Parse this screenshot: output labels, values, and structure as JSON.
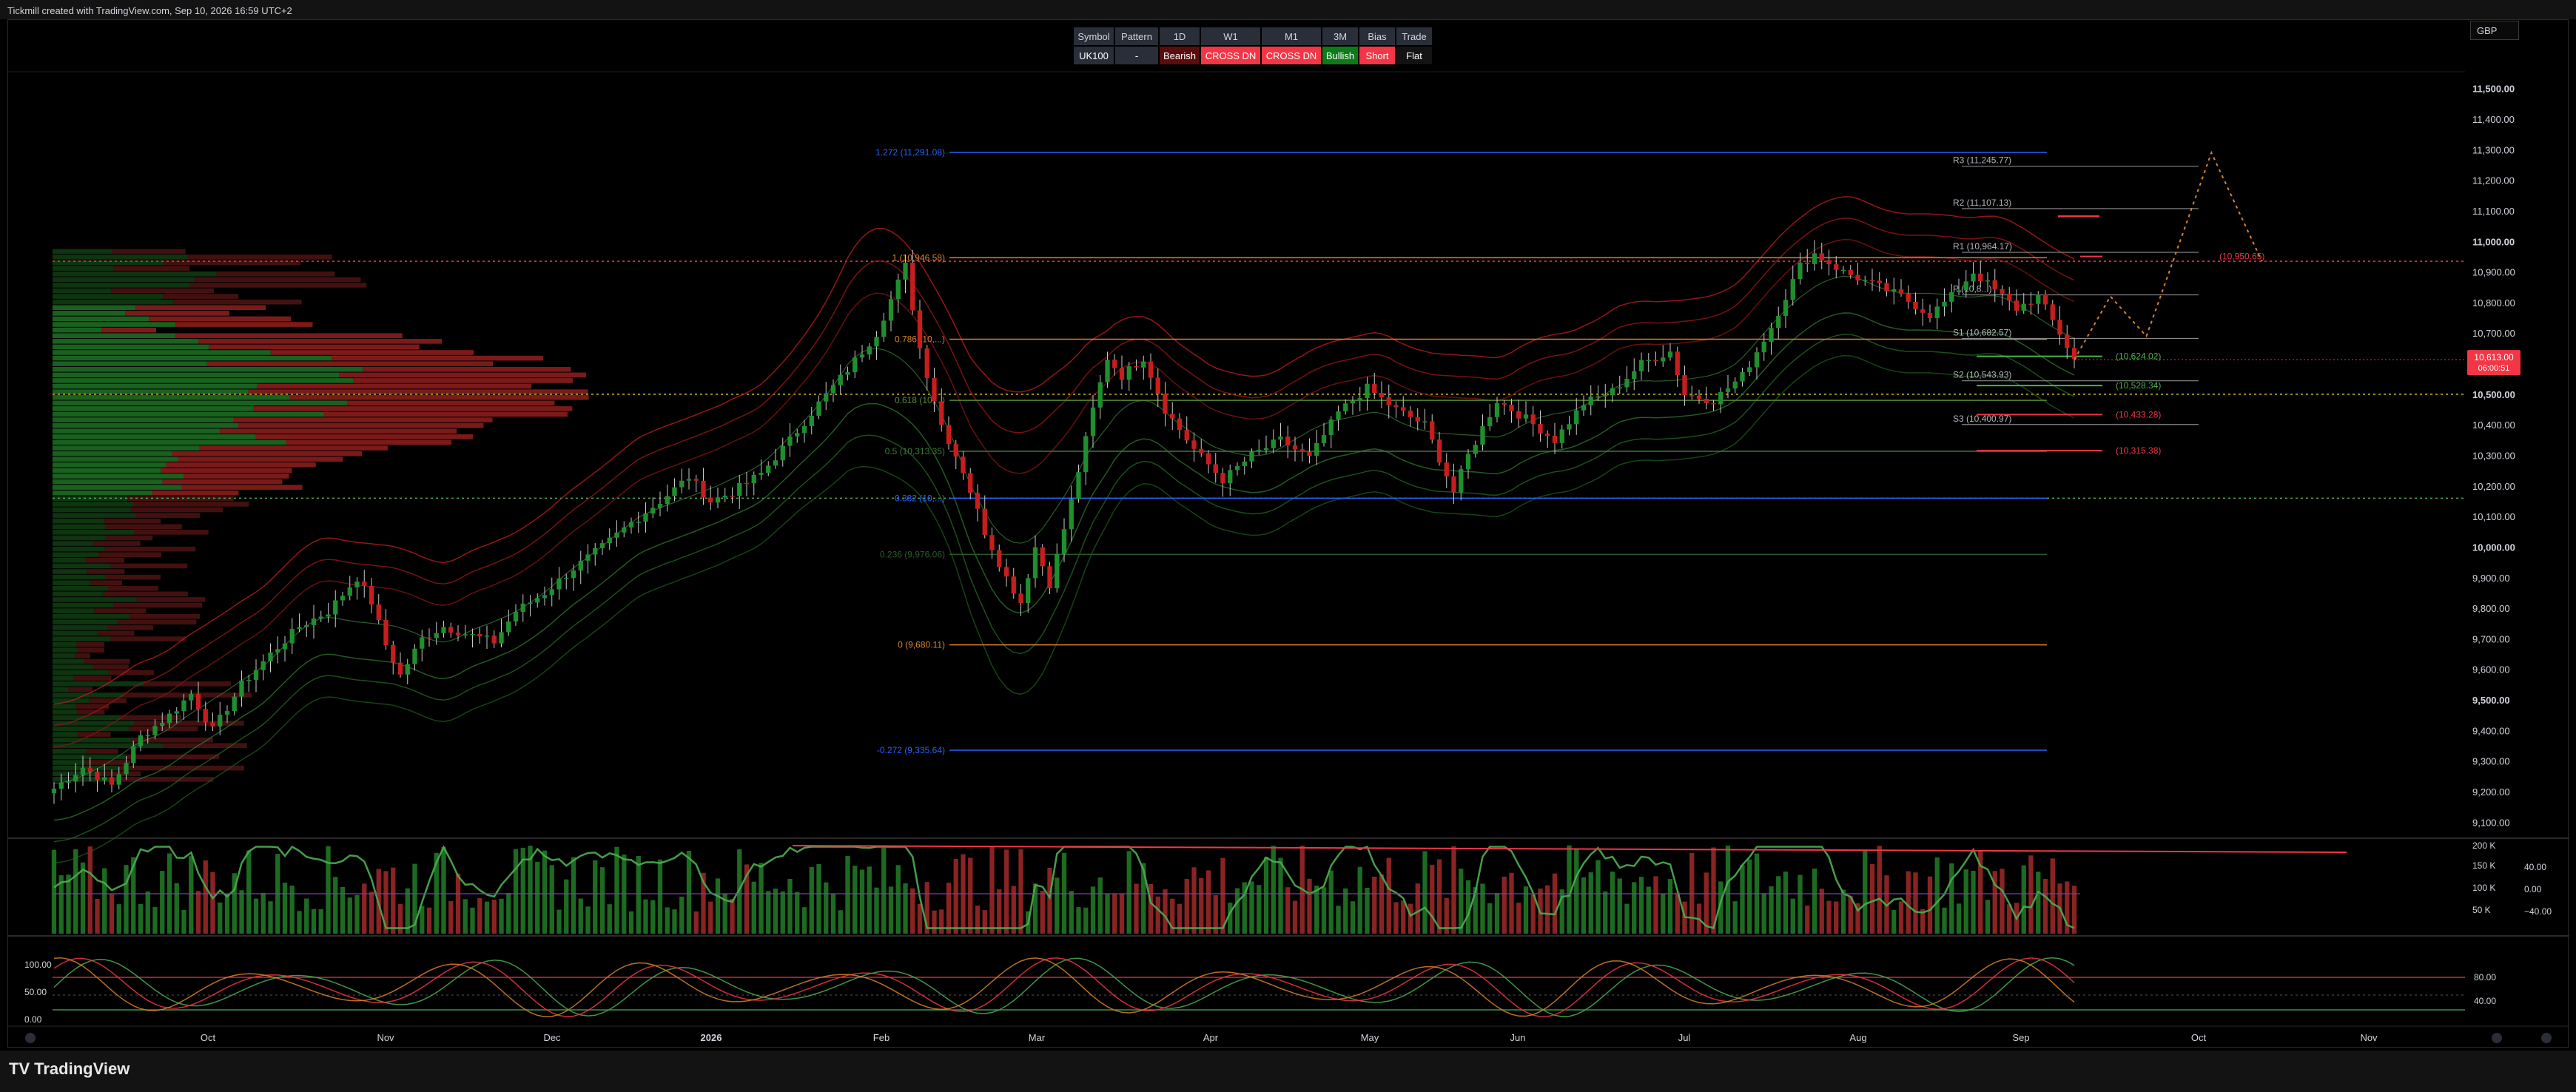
{
  "header": {
    "created_with": "Tickmill created with TradingView.com, Sep 10, 2026 16:59 UTC+2"
  },
  "currency_button": "GBP",
  "brand": {
    "mark": "TV",
    "name": "TradingView"
  },
  "colors": {
    "bull": "#1f8f2e",
    "bear": "#c81d1d",
    "fib_orange": "#d9822b",
    "fib_blue": "#2962ff",
    "poc": "#d4c316",
    "price_tag": "#f23645"
  },
  "info_table": {
    "headers": [
      "Symbol",
      "Pattern",
      "1D",
      "W1",
      "M1",
      "3M",
      "Bias",
      "Trade"
    ],
    "values": [
      "UK100",
      "-",
      "Bearish",
      "CROSS DN",
      "CROSS DN",
      "Bullish",
      "Short",
      "Flat"
    ],
    "cell_colors": [
      "#2a2e39",
      "#2a2e39",
      "#5a0d0d",
      "#f23645",
      "#f23645",
      "#0f7a1a",
      "#f23645",
      "#131313"
    ]
  },
  "chart_data": {
    "type": "candlestick",
    "symbol": "UK100",
    "y_axis": {
      "labels": [
        "11,500.00",
        "11,400.00",
        "11,300.00",
        "11,200.00",
        "11,100.00",
        "11,000.00",
        "10,900.00",
        "10,800.00",
        "10,700.00",
        "10,600.00",
        "10,500.00",
        "10,400.00",
        "10,300.00",
        "10,200.00",
        "10,100.00",
        "10,000.00",
        "9,900.00",
        "9,800.00",
        "9,700.00",
        "9,600.00",
        "9,500.00",
        "9,400.00",
        "9,300.00",
        "9,200.00",
        "9,100.00"
      ],
      "range": [
        9050,
        11550
      ]
    },
    "x_axis": {
      "labels": [
        "Oct",
        "Nov",
        "Dec",
        "2026",
        "Feb",
        "Mar",
        "Apr",
        "May",
        "Jun",
        "Jul",
        "Aug",
        "Sep",
        "Oct",
        "Nov"
      ]
    },
    "last_price": {
      "label": "10,613.00",
      "countdown": "06:00:51",
      "value": 10613
    },
    "price_path": [
      [
        0,
        9210
      ],
      [
        4,
        9280
      ],
      [
        8,
        9220
      ],
      [
        12,
        9380
      ],
      [
        16,
        9450
      ],
      [
        19,
        9520
      ],
      [
        22,
        9400
      ],
      [
        26,
        9550
      ],
      [
        30,
        9650
      ],
      [
        34,
        9740
      ],
      [
        38,
        9790
      ],
      [
        42,
        9900
      ],
      [
        44,
        9820
      ],
      [
        46,
        9680
      ],
      [
        48,
        9580
      ],
      [
        51,
        9700
      ],
      [
        54,
        9740
      ],
      [
        58,
        9710
      ],
      [
        61,
        9690
      ],
      [
        64,
        9790
      ],
      [
        68,
        9850
      ],
      [
        72,
        9930
      ],
      [
        76,
        10000
      ],
      [
        80,
        10080
      ],
      [
        84,
        10150
      ],
      [
        88,
        10230
      ],
      [
        91,
        10150
      ],
      [
        94,
        10180
      ],
      [
        98,
        10240
      ],
      [
        102,
        10350
      ],
      [
        106,
        10470
      ],
      [
        110,
        10580
      ],
      [
        114,
        10700
      ],
      [
        116,
        10810
      ],
      [
        118,
        10920
      ],
      [
        120,
        10650
      ],
      [
        123,
        10400
      ],
      [
        126,
        10250
      ],
      [
        129,
        10050
      ],
      [
        132,
        9900
      ],
      [
        134,
        9820
      ],
      [
        136,
        10000
      ],
      [
        138,
        9880
      ],
      [
        141,
        10150
      ],
      [
        144,
        10450
      ],
      [
        146,
        10620
      ],
      [
        148,
        10560
      ],
      [
        151,
        10620
      ],
      [
        154,
        10450
      ],
      [
        158,
        10320
      ],
      [
        162,
        10220
      ],
      [
        166,
        10300
      ],
      [
        170,
        10350
      ],
      [
        174,
        10290
      ],
      [
        178,
        10440
      ],
      [
        182,
        10520
      ],
      [
        186,
        10450
      ],
      [
        190,
        10400
      ],
      [
        194,
        10180
      ],
      [
        196,
        10300
      ],
      [
        200,
        10480
      ],
      [
        204,
        10420
      ],
      [
        208,
        10350
      ],
      [
        212,
        10470
      ],
      [
        216,
        10510
      ],
      [
        220,
        10600
      ],
      [
        224,
        10640
      ],
      [
        226,
        10500
      ],
      [
        230,
        10480
      ],
      [
        234,
        10560
      ],
      [
        238,
        10720
      ],
      [
        242,
        10920
      ],
      [
        244,
        10960
      ],
      [
        248,
        10900
      ],
      [
        252,
        10860
      ],
      [
        256,
        10820
      ],
      [
        260,
        10760
      ],
      [
        263,
        10820
      ],
      [
        266,
        10900
      ],
      [
        269,
        10840
      ],
      [
        272,
        10780
      ],
      [
        275,
        10820
      ],
      [
        278,
        10700
      ],
      [
        280,
        10613
      ]
    ],
    "price_path_x_range": [
      0,
      280
    ],
    "volume_profile": {
      "rows": 95,
      "top_value": 10975,
      "bottom_value": 9230,
      "poc_value": 10500,
      "value_area_low": 10160
    },
    "fibonacci": [
      {
        "label": "1.272 (11,291.08)",
        "value": 11291.08,
        "color": "#2962ff"
      },
      {
        "label": "1 (10,946.58)",
        "value": 10946.58,
        "color": "#d9822b"
      },
      {
        "label": "0.786 (10,...)",
        "value": 10680,
        "color": "#d9822b"
      },
      {
        "label": "0.618 (10,...)",
        "value": 10480,
        "color": "#5a8a2e"
      },
      {
        "label": "0.5 (10,313.35)",
        "value": 10313.35,
        "color": "#3a7a3a"
      },
      {
        "label": "0.382 (10,...)",
        "value": 10160,
        "color": "#2962ff"
      },
      {
        "label": "0.236 (9,976.06)",
        "value": 9976.06,
        "color": "#2e5a2e"
      },
      {
        "label": "0 (9,680.11)",
        "value": 9680.11,
        "color": "#d9822b"
      },
      {
        "label": "-0.272 (9,335.64)",
        "value": 9335.64,
        "color": "#2962ff"
      }
    ],
    "pivots": [
      {
        "label": "R3 (11,245.77)",
        "value": 11245.77
      },
      {
        "label": "R2 (11,107.13)",
        "value": 11107.13
      },
      {
        "label": "R1 (10,964.17)",
        "value": 10964.17
      },
      {
        "label": "P (10,8...)",
        "value": 10825
      },
      {
        "label": "S1 (10,682.57)",
        "value": 10682.57
      },
      {
        "label": "S2 (10,543.93)",
        "value": 10543.93
      },
      {
        "label": "S3 (10,400.97)",
        "value": 10400.97
      }
    ],
    "targets": [
      {
        "label": "(10,624.02)",
        "value": 10624.02,
        "color": "#4caf50"
      },
      {
        "label": "(10,528.34)",
        "value": 10528.34,
        "color": "#4caf50"
      },
      {
        "label": "(10,433.28)",
        "value": 10433.28,
        "color": "#f23645"
      },
      {
        "label": "(10,315.38)",
        "value": 10315.38,
        "color": "#f23645"
      },
      {
        "label": "(10,950.65)",
        "value": 10950.65,
        "color": "#f23645"
      }
    ],
    "horizontal_lines": [
      {
        "value": 10935,
        "color": "#f23645",
        "style": "dotted"
      },
      {
        "value": 10500,
        "color": "#d4c316",
        "style": "dotted"
      },
      {
        "value": 10160,
        "color": "#4caf50",
        "style": "dotted"
      }
    ],
    "projection": [
      [
        280,
        10613
      ],
      [
        285,
        10820
      ],
      [
        290,
        10690
      ],
      [
        299,
        11290
      ],
      [
        306,
        10935
      ]
    ],
    "volume_panel": {
      "labels": [
        "200 K",
        "150 K",
        "100 K",
        "50 K"
      ],
      "osc_labels": [
        "40.00",
        "0.00",
        "−40.00"
      ]
    },
    "stoch_panel": {
      "labels": [
        "100.00",
        "50.00",
        "0.00"
      ],
      "right_labels": [
        "80.00",
        "40.00"
      ]
    }
  }
}
